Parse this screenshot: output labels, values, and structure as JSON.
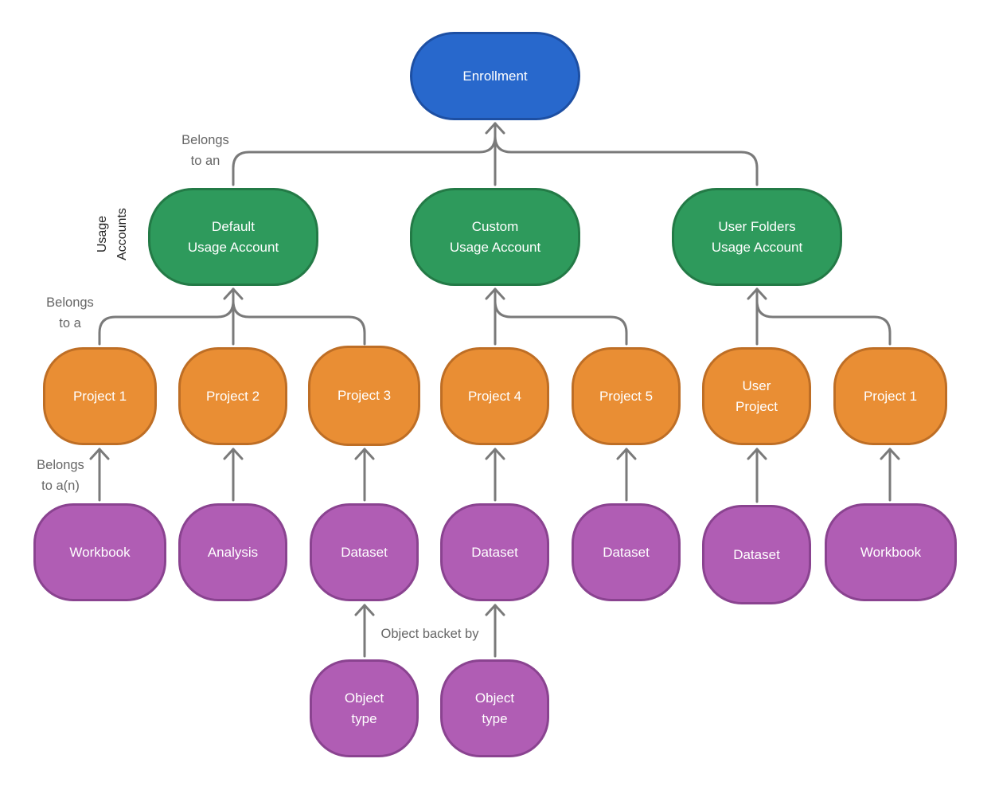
{
  "diagram": {
    "colors": {
      "root": "#2868cc",
      "usage_account": "#2e9a5c",
      "project": "#e98e34",
      "object": "#b05db4",
      "connector": "#7a7a7a"
    },
    "root": {
      "id": "enrollment",
      "label": "Enrollment"
    },
    "usage_accounts": [
      {
        "id": "ua-default",
        "label": "Default\nUsage Account"
      },
      {
        "id": "ua-custom",
        "label": "Custom\nUsage Account"
      },
      {
        "id": "ua-user-folders",
        "label": "User Folders\nUsage Account"
      }
    ],
    "projects": [
      {
        "id": "p1",
        "label": "Project 1",
        "parent": "ua-default"
      },
      {
        "id": "p2",
        "label": "Project 2",
        "parent": "ua-default"
      },
      {
        "id": "p3",
        "label": "Project 3",
        "parent": "ua-default"
      },
      {
        "id": "p4",
        "label": "Project 4",
        "parent": "ua-custom"
      },
      {
        "id": "p5",
        "label": "Project 5",
        "parent": "ua-custom"
      },
      {
        "id": "p6",
        "label": "User\nProject",
        "parent": "ua-user-folders"
      },
      {
        "id": "p7",
        "label": "Project 1",
        "parent": "ua-user-folders"
      }
    ],
    "objects": [
      {
        "id": "o1",
        "label": "Workbook",
        "parent": "p1"
      },
      {
        "id": "o2",
        "label": "Analysis",
        "parent": "p2"
      },
      {
        "id": "o3",
        "label": "Dataset",
        "parent": "p3"
      },
      {
        "id": "o4",
        "label": "Dataset",
        "parent": "p4"
      },
      {
        "id": "o5",
        "label": "Dataset",
        "parent": "p5"
      },
      {
        "id": "o6",
        "label": "Dataset",
        "parent": "p6"
      },
      {
        "id": "o7",
        "label": "Workbook",
        "parent": "p7"
      }
    ],
    "object_types": [
      {
        "id": "t1",
        "label": "Object\ntype",
        "parent": "o3"
      },
      {
        "id": "t2",
        "label": "Object\ntype",
        "parent": "o4"
      }
    ],
    "edge_labels": {
      "belongs_to_an": "Belongs\nto an",
      "belongs_to_a": "Belongs\nto a",
      "belongs_to_a_n": "Belongs\nto a(n)",
      "object_backet_by": "Object backet by"
    },
    "side_label": "Usage\nAccounts"
  }
}
